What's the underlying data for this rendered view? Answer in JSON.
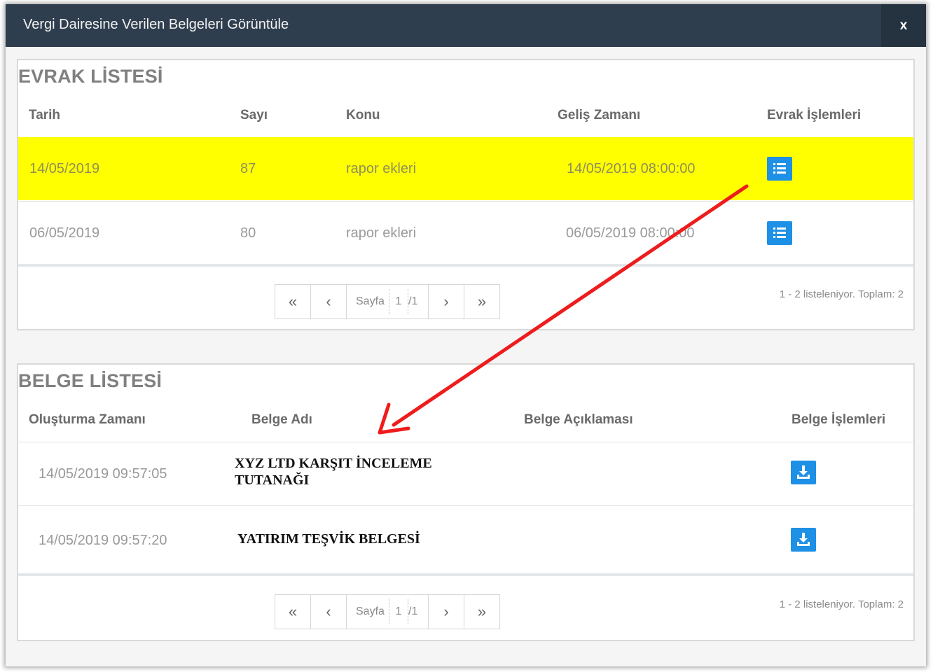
{
  "dialog": {
    "title": "Vergi Dairesine Verilen Belgeleri Görüntüle",
    "close_label": "x"
  },
  "evrak": {
    "title": "EVRAK LİSTESİ",
    "columns": [
      "Tarih",
      "Sayı",
      "Konu",
      "Geliş Zamanı",
      "Evrak İşlemleri"
    ],
    "rows": [
      {
        "tarih": "14/05/2019",
        "sayi": "87",
        "konu": "rapor ekleri",
        "gelis": "14/05/2019 08:00:00",
        "action_icon": "list-icon",
        "highlighted": true
      },
      {
        "tarih": "06/05/2019",
        "sayi": "80",
        "konu": "rapor ekleri",
        "gelis": "06/05/2019 08:00:00",
        "action_icon": "list-icon",
        "highlighted": false
      }
    ],
    "pager": {
      "first": "«",
      "prev": "‹",
      "label": "Sayfa",
      "page": "1",
      "total": "/1",
      "next": "›",
      "last": "»"
    },
    "record_info": "1 - 2 listeleniyor. Toplam: 2"
  },
  "belge": {
    "title": "BELGE LİSTESİ",
    "columns": [
      "Oluşturma Zamanı",
      "Belge Adı",
      "Belge Açıklaması",
      "Belge İşlemleri"
    ],
    "rows": [
      {
        "zaman": "14/05/2019 09:57:05",
        "adi_line1": "XYZ LTD KARŞIT İNCELEME",
        "adi_line2": "TUTANAĞI",
        "aciklama": "",
        "action_icon": "download-icon"
      },
      {
        "zaman": "14/05/2019 09:57:20",
        "adi_line1": "YATIRIM TEŞVİK BELGESİ",
        "adi_line2": "",
        "aciklama": "",
        "action_icon": "download-icon"
      }
    ],
    "pager": {
      "first": "«",
      "prev": "‹",
      "label": "Sayfa",
      "page": "1",
      "total": "/1",
      "next": "›",
      "last": "»"
    },
    "record_info": "1 - 2 listeleniyor. Toplam: 2"
  },
  "colors": {
    "header_bg": "#2f3e4f",
    "highlight": "#ffff00",
    "button_blue": "#1e90e6",
    "annotation_arrow": "#ee1c1c"
  }
}
